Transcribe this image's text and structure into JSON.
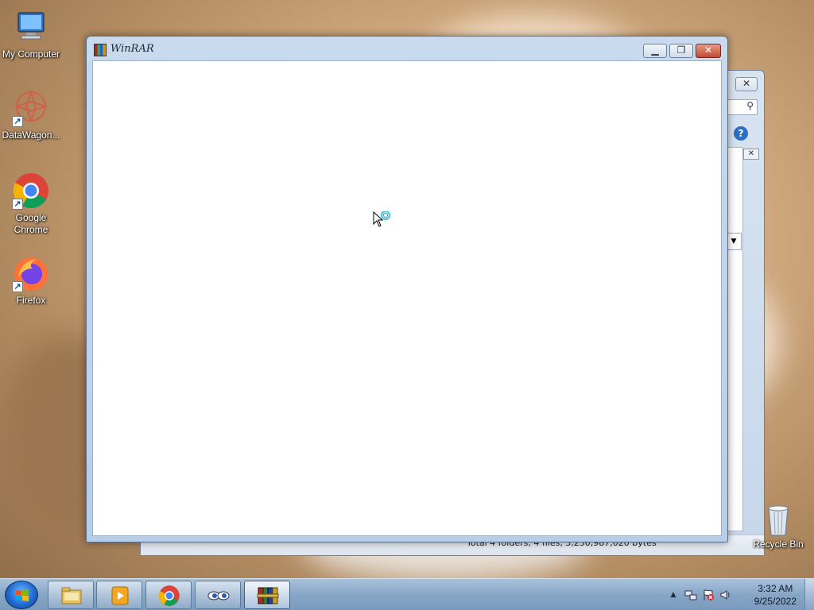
{
  "desktop": {
    "icons": [
      {
        "label": "My Computer",
        "icon": "computer-icon"
      },
      {
        "label": "DataWagon...",
        "icon": "datawagon-icon"
      },
      {
        "label": "Google Chrome",
        "icon": "chrome-icon"
      },
      {
        "label": "Firefox",
        "icon": "firefox-icon"
      }
    ],
    "recycle_bin": {
      "label": "Recycle Bin",
      "icon": "recycle-bin-icon"
    }
  },
  "winrar": {
    "title": "WinRAR",
    "minimize_symbol": "▁",
    "maximize_symbol": "❐",
    "close_symbol": "✕"
  },
  "background_window": {
    "close_symbol": "✕",
    "search_symbol": "⚲",
    "help_symbol": "?",
    "dropdown_symbol": "▼",
    "status_text": "Total 4 folders, 4 files, 3,250,987,020 bytes"
  },
  "taskbar": {
    "buttons": [
      {
        "name": "explorer",
        "icon": "folder-icon"
      },
      {
        "name": "media-player",
        "icon": "media-player-icon"
      },
      {
        "name": "chrome",
        "icon": "chrome-icon"
      },
      {
        "name": "eyes-app",
        "icon": "eyes-icon"
      },
      {
        "name": "winrar",
        "icon": "winrar-icon",
        "active": true
      }
    ],
    "tray": {
      "show_hidden": "▲",
      "time": "3:32 AM",
      "date": "9/25/2022"
    }
  },
  "colors": {
    "taskbar": "#87a6c6",
    "window_frame": "#b8cde6",
    "close_button": "#c34a33"
  }
}
